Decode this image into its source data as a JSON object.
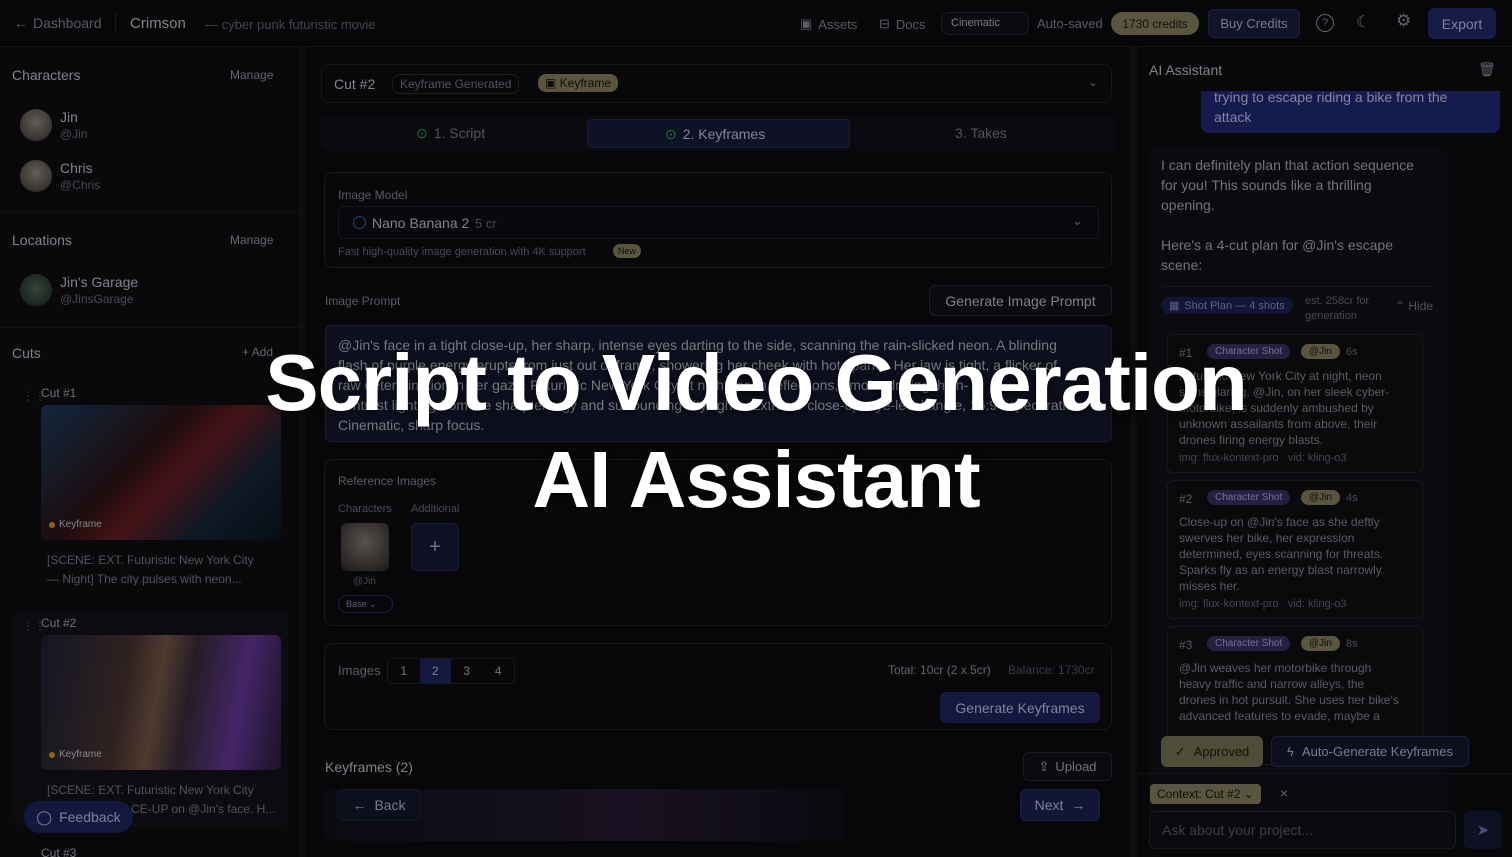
{
  "topbar": {
    "back_label": "Dashboard",
    "project_name": "Crimson",
    "project_subtitle": "— cyber punk futuristic movie",
    "assets_label": "Assets",
    "docs_label": "Docs",
    "style_value": "Cinematic",
    "autosave": "Auto-saved",
    "credits": "1730 credits",
    "buy_credits": "Buy Credits",
    "export": "Export"
  },
  "sidebar": {
    "characters_title": "Characters",
    "characters_manage": "Manage",
    "characters": [
      {
        "name": "Jin",
        "handle": "@Jin"
      },
      {
        "name": "Chris",
        "handle": "@Chris"
      }
    ],
    "locations_title": "Locations",
    "locations_manage": "Manage",
    "locations": [
      {
        "name": "Jin's Garage",
        "handle": "@JinsGarage"
      }
    ],
    "cuts_title": "Cuts",
    "cuts_add": "+ Add",
    "cuts": [
      {
        "title": "Cut #1",
        "tag": "Keyframe",
        "line1": "[SCENE: EXT. Futuristic New York City",
        "line2": "— Night] The city pulses with neon..."
      },
      {
        "title": "Cut #2",
        "tag": "Keyframe",
        "line1": "[SCENE: EXT. Futuristic New York City",
        "line2": "CE-UP on @Jin's face. H..."
      },
      {
        "title": "Cut #3"
      }
    ],
    "feedback": "Feedback"
  },
  "main": {
    "cut_title": "Cut #2",
    "status_badge": "Keyframe Generated",
    "type_badge": "Keyframe",
    "steps": [
      "1. Script",
      "2. Keyframes",
      "3. Takes"
    ],
    "image_model_label": "Image Model",
    "image_model_value": "Nano Banana 2",
    "image_model_cost": "5 cr",
    "image_model_desc": "Fast high-quality image generation with 4K support",
    "new_badge": "New",
    "image_prompt_label": "Image Prompt",
    "generate_prompt_btn": "Generate Image Prompt",
    "prompt_lines": [
      "@Jin's face in a tight close-up, her sharp, intense eyes darting to the side, scanning the rain-slicked neon. A blinding",
      "flash of purple energy erupts from just out of frame, showering her cheek with hot sparks. Her jaw is tight, a flicker of",
      "raw determination in her gaze. Futuristic New York City at night, neon reflections, smoke drifting, high-",
      "contrast lighting from the sharp energy and surrounding city lights. Extreme close-up, eye-level angle, 16:9 aspect ratio.",
      "Cinematic, sharp focus."
    ],
    "reference_label": "Reference Images",
    "ref_characters": "Characters",
    "ref_additional": "Additional",
    "ref_char_handle": "@Jin",
    "ref_base": "Base",
    "images_label": "Images",
    "image_counts": [
      "1",
      "2",
      "3",
      "4"
    ],
    "total_text": "Total: 10cr (2 x 5cr)",
    "balance_text": "Balance: 1730cr",
    "generate_keyframes": "Generate Keyframes",
    "keyframes_title": "Keyframes (2)",
    "upload": "Upload",
    "back": "Back",
    "next": "Next"
  },
  "assistant": {
    "title": "AI Assistant",
    "user_msg_1": "trying to escape riding a bike from the",
    "user_msg_2": "attack",
    "reply_1": "I can definitely plan that action sequence",
    "reply_2": "for you! This sounds like a thrilling",
    "reply_3": "opening.",
    "reply_4": "Here's a 4-cut plan for @Jin's escape",
    "reply_5": "scene:",
    "shot_plan": "Shot Plan — 4 shots",
    "est_1": "est. 258cr for",
    "est_2": "generation",
    "hide": "Hide",
    "shots": [
      {
        "num": "#1",
        "type": "Character Shot",
        "char": "@Jin",
        "dur": "6s",
        "lines": [
          "Futuristic New York City at night, neon",
          "signs glaring. @Jin, on her sleek cyber-",
          "motorbike, is suddenly ambushed by",
          "unknown assailants from above, their",
          "drones firing energy blasts."
        ],
        "meta": "img: flux-kontext-pro   vid: kling-o3"
      },
      {
        "num": "#2",
        "type": "Character Shot",
        "char": "@Jin",
        "dur": "4s",
        "lines": [
          "Close-up on @Jin's face as she deftly",
          "swerves her bike, her expression",
          "determined, eyes scanning for threats.",
          "Sparks fly as an energy blast narrowly",
          "misses her."
        ],
        "meta": "img: flux-kontext-pro   vid: kling-o3"
      },
      {
        "num": "#3",
        "type": "Character Shot",
        "char": "@Jin",
        "dur": "8s",
        "lines": [
          "@Jin weaves her motorbike through",
          "heavy traffic and narrow alleys, the",
          "drones in hot pursuit. She uses her bike's",
          "advanced features to evade, maybe a"
        ]
      }
    ],
    "approved": "Approved",
    "auto_generate": "Auto-Generate Keyframes",
    "context": "Context: Cut #2",
    "input_placeholder": "Ask about your project..."
  },
  "overlay": {
    "line1": "Script to Video Generation",
    "line2": "AI Assistant"
  }
}
